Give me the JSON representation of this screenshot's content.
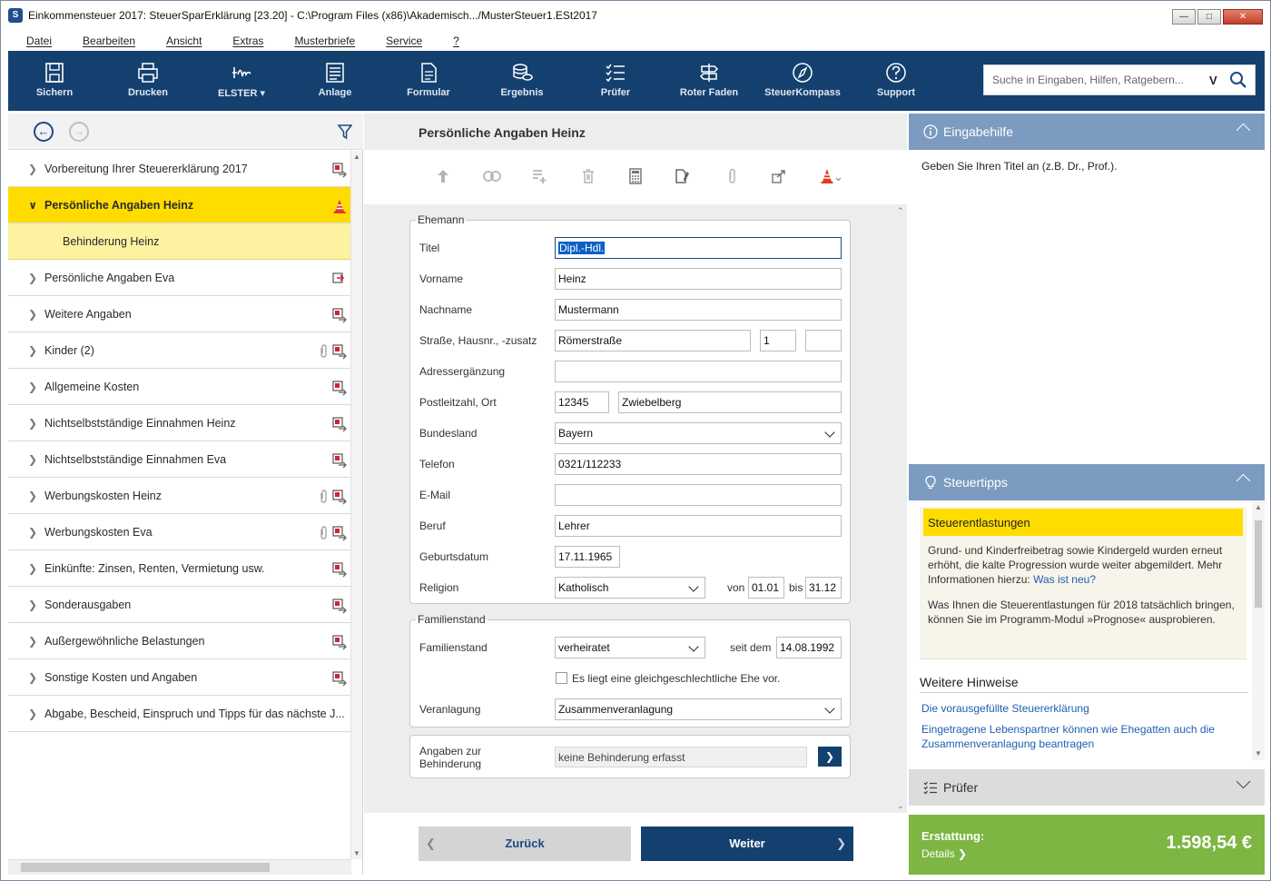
{
  "window": {
    "title": "Einkommensteuer 2017: SteuerSparErklärung [23.20] - C:\\Program Files (x86)\\Akademisch.../MusterSteuer1.ESt2017"
  },
  "menu": [
    "Datei",
    "Bearbeiten",
    "Ansicht",
    "Extras",
    "Musterbriefe",
    "Service",
    "?"
  ],
  "toolbar": {
    "buttons": [
      {
        "label": "Sichern",
        "icon": "save-icon"
      },
      {
        "label": "Drucken",
        "icon": "print-icon"
      },
      {
        "label": "ELSTER",
        "icon": "elster-icon"
      },
      {
        "label": "Anlage",
        "icon": "form-list-icon"
      },
      {
        "label": "Formular",
        "icon": "document-icon"
      },
      {
        "label": "Ergebnis",
        "icon": "coins-icon"
      },
      {
        "label": "Prüfer",
        "icon": "checklist-icon"
      },
      {
        "label": "Roter Faden",
        "icon": "signpost-icon"
      },
      {
        "label": "SteuerKompass",
        "icon": "compass-icon"
      },
      {
        "label": "Support",
        "icon": "help-icon"
      }
    ],
    "search_placeholder": "Suche in Eingaben, Hilfen, Ratgebern...",
    "search_mode": "V"
  },
  "nav": {
    "items": [
      {
        "label": "Vorbereitung Ihrer Steuererklärung 2017"
      },
      {
        "label": "Persönliche Angaben Heinz"
      },
      {
        "label": "Behinderung Heinz"
      },
      {
        "label": "Persönliche Angaben Eva"
      },
      {
        "label": "Weitere Angaben"
      },
      {
        "label": "Kinder (2)"
      },
      {
        "label": "Allgemeine Kosten"
      },
      {
        "label": "Nichtselbstständige Einnahmen Heinz"
      },
      {
        "label": "Nichtselbstständige Einnahmen Eva"
      },
      {
        "label": "Werbungskosten Heinz"
      },
      {
        "label": "Werbungskosten Eva"
      },
      {
        "label": "Einkünfte: Zinsen, Renten, Vermietung usw."
      },
      {
        "label": "Sonderausgaben"
      },
      {
        "label": "Außergewöhnliche Belastungen"
      },
      {
        "label": "Sonstige Kosten und Angaben"
      },
      {
        "label": "Abgabe, Bescheid, Einspruch und Tipps für das nächste J..."
      }
    ]
  },
  "page": {
    "title": "Persönliche Angaben Heinz"
  },
  "form": {
    "ehemann": {
      "legend": "Ehemann",
      "titel_label": "Titel",
      "titel": "Dipl.-Hdl.",
      "vorname_label": "Vorname",
      "vorname": "Heinz",
      "nachname_label": "Nachname",
      "nachname": "Mustermann",
      "strasse_label": "Straße, Hausnr., -zusatz",
      "strasse": "Römerstraße",
      "hausnr": "1",
      "zusatz": "",
      "adresse_label": "Adressergänzung",
      "adresse": "",
      "plz_label": "Postleitzahl, Ort",
      "plz": "12345",
      "ort": "Zwiebelberg",
      "bundesland_label": "Bundesland",
      "bundesland": "Bayern",
      "telefon_label": "Telefon",
      "telefon": "0321/112233",
      "email_label": "E-Mail",
      "email": "",
      "beruf_label": "Beruf",
      "beruf": "Lehrer",
      "geburtsdatum_label": "Geburtsdatum",
      "geburtsdatum": "17.11.1965",
      "religion_label": "Religion",
      "religion": "Katholisch",
      "von_label": "von",
      "von": "01.01",
      "bis_label": "bis",
      "bis": "31.12"
    },
    "familienstand": {
      "legend": "Familienstand",
      "familienstand_label": "Familienstand",
      "familienstand": "verheiratet",
      "seit_label": "seit dem",
      "seit": "14.08.1992",
      "gleichgeschlechtlich_label": "Es liegt eine gleichgeschlechtliche Ehe vor.",
      "veranlagung_label": "Veranlagung",
      "veranlagung": "Zusammenveranlagung"
    },
    "behinderung": {
      "label": "Angaben zur Behinderung",
      "value": "keine Behinderung erfasst"
    }
  },
  "buttons": {
    "back": "Zurück",
    "next": "Weiter"
  },
  "help": {
    "header": "Eingabehilfe",
    "text": "Geben Sie Ihren Titel an (z.B. Dr., Prof.)."
  },
  "tips": {
    "header": "Steuertipps",
    "box_title": "Steuerentlastungen",
    "p1": "Grund- und Kinderfreibetrag sowie Kindergeld wurden erneut erhöht, die kalte Progression wurde weiter abgemildert. Mehr Informationen hierzu:",
    "p1_link": "Was ist neu?",
    "p2": "Was Ihnen die Steuerentlastungen für 2018 tatsächlich bringen, können Sie im Programm-Modul »Prognose« ausprobieren.",
    "weitere_title": "Weitere Hinweise",
    "link1": "Die vorausgefüllte Steuererklärung",
    "link2": "Eingetragene Lebenspartner können wie Ehegatten auch die Zusammenveranlagung beantragen"
  },
  "pruefer": {
    "header": "Prüfer"
  },
  "refund": {
    "label": "Erstattung:",
    "details": "Details",
    "amount": "1.598,54 €"
  },
  "colors": {
    "toolbar": "#14406f",
    "accent": "#ffdc00",
    "refund": "#7db642",
    "panel_header": "#7c9bc0"
  }
}
